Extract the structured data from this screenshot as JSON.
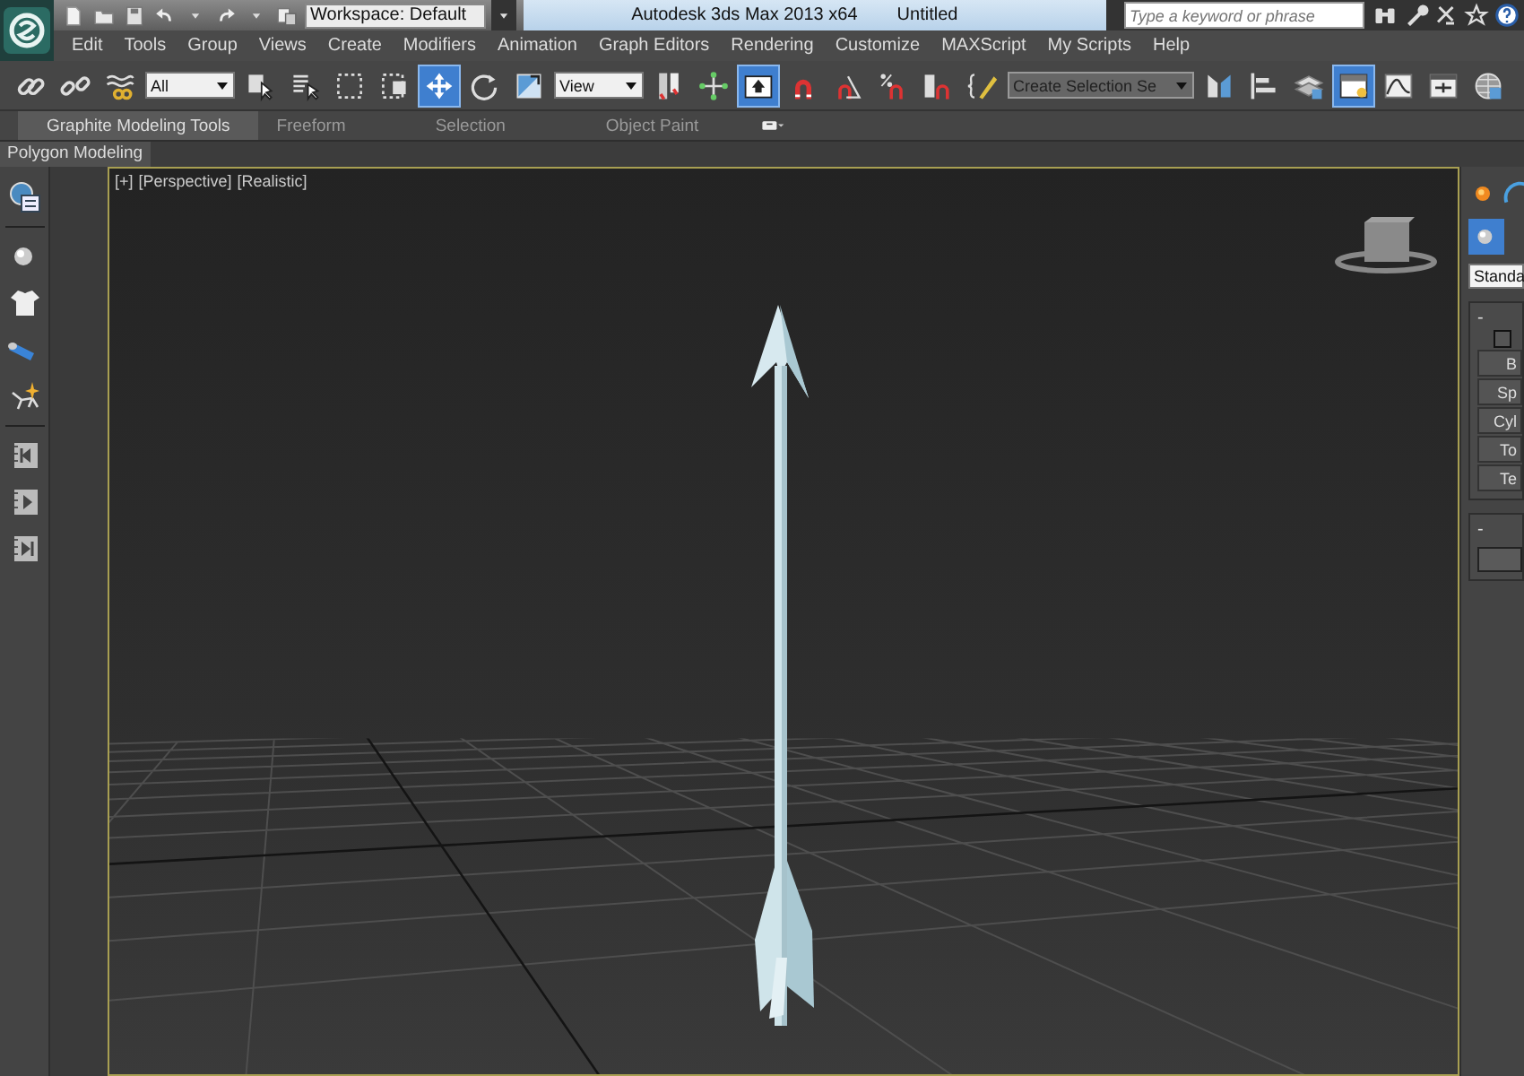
{
  "title_bar": {
    "workspace": "Workspace: Default",
    "app_title": "Autodesk 3ds Max 2013 x64",
    "document": "Untitled",
    "search": {
      "placeholder": "Type a keyword or phrase"
    }
  },
  "menu": [
    "Edit",
    "Tools",
    "Group",
    "Views",
    "Create",
    "Modifiers",
    "Animation",
    "Graph Editors",
    "Rendering",
    "Customize",
    "MAXScript",
    "My Scripts",
    "Help"
  ],
  "toolbar": [
    {
      "kind": "button",
      "selected": false
    },
    {
      "kind": "button",
      "selected": false
    },
    {
      "kind": "button",
      "selected": false
    },
    {
      "kind": "dropdown",
      "value": "All",
      "disabled": false
    },
    {
      "kind": "button",
      "selected": false
    },
    {
      "kind": "button",
      "selected": false
    },
    {
      "kind": "button",
      "selected": false
    },
    {
      "kind": "button",
      "selected": false
    },
    {
      "kind": "button",
      "selected": true
    },
    {
      "kind": "button",
      "selected": false
    },
    {
      "kind": "button",
      "selected": false
    },
    {
      "kind": "dropdown",
      "value": "View",
      "disabled": false
    },
    {
      "kind": "button",
      "selected": false
    },
    {
      "kind": "button",
      "selected": false
    },
    {
      "kind": "button",
      "selected": true
    },
    {
      "kind": "button",
      "selected": false
    },
    {
      "kind": "button",
      "selected": false
    },
    {
      "kind": "button",
      "selected": false
    },
    {
      "kind": "button",
      "selected": false
    },
    {
      "kind": "button",
      "selected": false
    },
    {
      "kind": "dropdown",
      "value": "Create Selection Se",
      "disabled": true
    },
    {
      "kind": "button",
      "selected": false
    },
    {
      "kind": "button",
      "selected": false
    },
    {
      "kind": "button",
      "selected": false
    },
    {
      "kind": "button",
      "selected": true
    },
    {
      "kind": "button",
      "selected": false
    },
    {
      "kind": "button",
      "selected": false
    },
    {
      "kind": "button",
      "selected": false
    }
  ],
  "ribbon": {
    "tabs": [
      {
        "label": "Graphite Modeling Tools",
        "selected": true
      },
      {
        "label": "Freeform",
        "selected": false
      },
      {
        "label": "Selection",
        "selected": false
      },
      {
        "label": "Object Paint",
        "selected": false
      }
    ],
    "panel": "Polygon Modeling"
  },
  "viewport": {
    "labels": [
      "[+]",
      "[Perspective]",
      "[Realistic]"
    ]
  },
  "command_panel": {
    "dropdown": "Standa",
    "rollouts": [
      {
        "toggle": "-",
        "checkbox": {
          "checked": false
        },
        "buttons": [
          "B",
          "Sp",
          "Cyl",
          "To",
          "Te"
        ]
      },
      {
        "toggle": "-"
      }
    ]
  }
}
